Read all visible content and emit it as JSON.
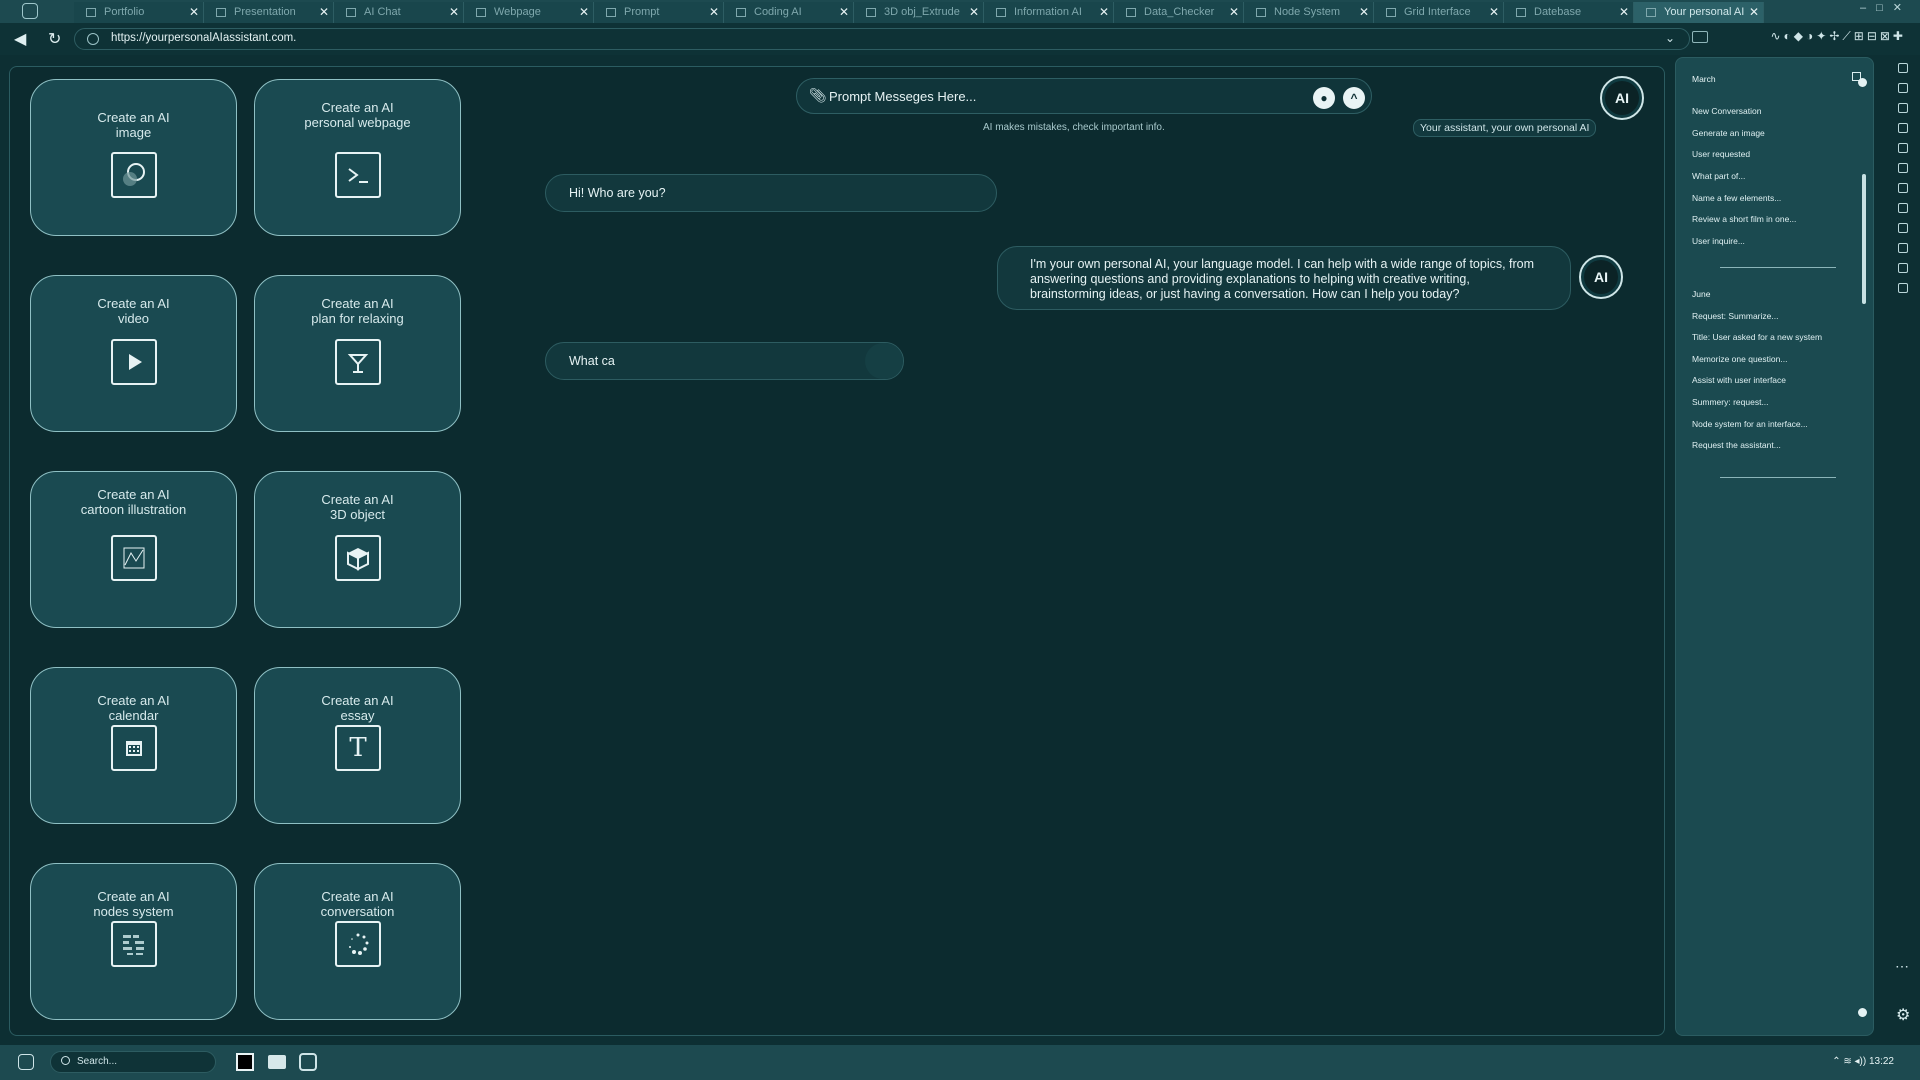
{
  "tabs": [
    {
      "label": "Portfolio"
    },
    {
      "label": "Presentation"
    },
    {
      "label": "AI Chat"
    },
    {
      "label": "Webpage"
    },
    {
      "label": "Prompt"
    },
    {
      "label": "Coding AI"
    },
    {
      "label": "3D obj_Extrude"
    },
    {
      "label": "Information AI"
    },
    {
      "label": "Data_Checker"
    },
    {
      "label": "Node System"
    },
    {
      "label": "Grid Interface"
    },
    {
      "label": "Datebase"
    },
    {
      "label": "Your personal AI"
    }
  ],
  "address": {
    "url": "https://yourpersonalAIassistant.com."
  },
  "cards": [
    {
      "line1": "Create an AI",
      "line2": "image",
      "icon": "image-icon"
    },
    {
      "line1": "Create an AI",
      "line2": "personal webpage",
      "icon": "terminal-icon"
    },
    {
      "line1": "Create an AI",
      "line2": "video",
      "icon": "play-icon"
    },
    {
      "line1": "Create an AI",
      "line2": "plan for relaxing",
      "icon": "cocktail-icon"
    },
    {
      "line1": "Create an AI",
      "line2": "cartoon illustration",
      "icon": "illustration-icon"
    },
    {
      "line1": "Create an AI",
      "line2": "3D object",
      "icon": "cube-icon"
    },
    {
      "line1": "Create an AI",
      "line2": "calendar",
      "icon": "calendar-icon"
    },
    {
      "line1": "Create an AI",
      "line2": "essay",
      "icon": "text-icon"
    },
    {
      "line1": "Create an AI",
      "line2": "nodes system",
      "icon": "nodes-icon"
    },
    {
      "line1": "Create an AI",
      "line2": "conversation",
      "icon": "loading-dots-icon"
    }
  ],
  "prompt": {
    "placeholder": "Prompt Messeges Here...",
    "disclaimer": "AI makes mistakes, check important info."
  },
  "assistant": {
    "avatar_text": "AI",
    "tagline": "Your assistant, your own personal AI"
  },
  "messages": [
    {
      "role": "user",
      "text": "Hi! Who are you?"
    },
    {
      "role": "assistant",
      "text": "I'm your own personal AI, your language model. I can help with a wide range of topics, from answering questions and providing explanations to helping with creative writing, brainstorming ideas, or just having a conversation. How can I help you today?"
    },
    {
      "role": "user",
      "text": "What ca"
    }
  ],
  "sidebar": {
    "groups": [
      {
        "month": "March",
        "items": [
          "New Conversation",
          "Generate an image",
          "User requested",
          "What part of...",
          "Name a few elements...",
          "Review a short film in one...",
          "User inquire..."
        ]
      },
      {
        "month": "June",
        "items": [
          "Request: Summarize...",
          "Title: User asked for a new system",
          "Memorize one question...",
          "Assist with user interface",
          "Summery: request...",
          "Node system for an interface...",
          "Request the assistant..."
        ]
      }
    ]
  },
  "taskbar": {
    "search_placeholder": "Search...",
    "clock": "13:22"
  },
  "colors": {
    "background": "#0d2f33",
    "panel": "#1a4a51",
    "accent": "#8fc0c4"
  }
}
